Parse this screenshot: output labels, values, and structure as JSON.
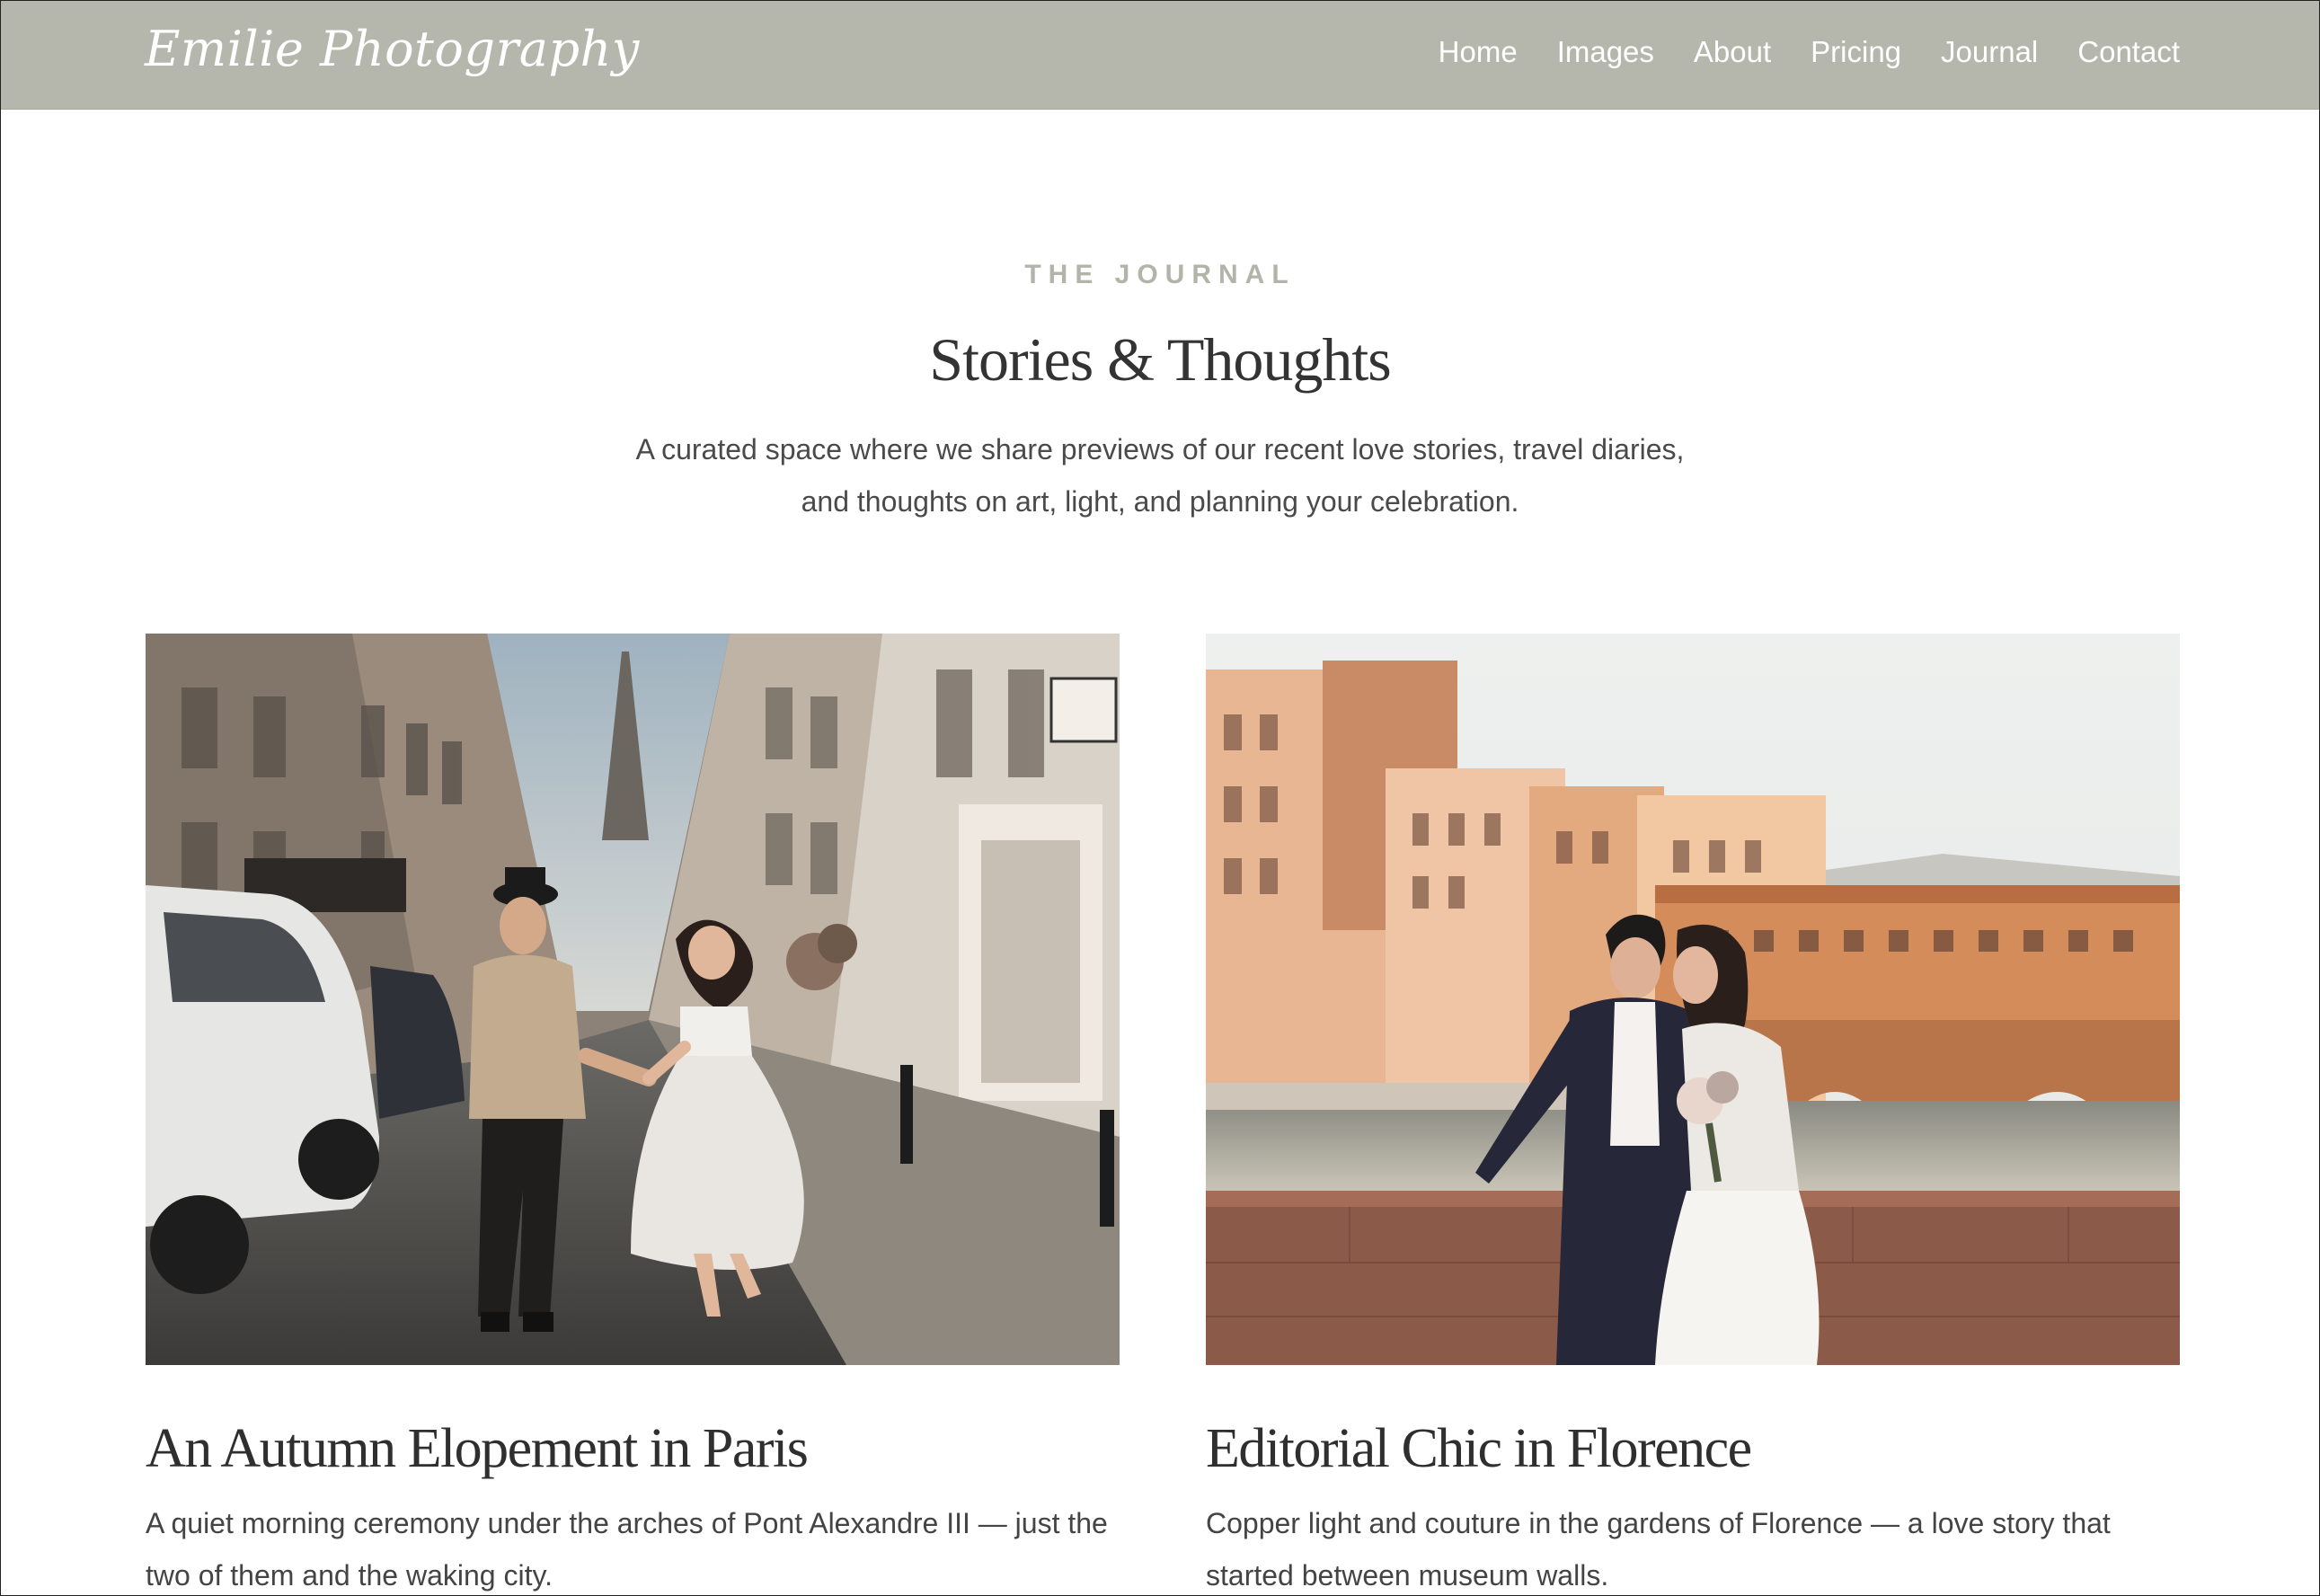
{
  "header": {
    "logo": "Emilie Photography",
    "nav": [
      "Home",
      "Images",
      "About",
      "Pricing",
      "Journal",
      "Contact"
    ]
  },
  "intro": {
    "eyebrow": "THE JOURNAL",
    "title": "Stories & Thoughts",
    "description": "A curated space where we share previews of our recent love stories, travel diaries, and thoughts on art, light, and planning your celebration."
  },
  "posts": [
    {
      "title": "An Autumn Elopement in Paris",
      "excerpt": "A quiet morning ceremony under the arches of Pont Alexandre III — just the two of them and the waking city.",
      "image": "paris-street-couple-photo"
    },
    {
      "title": "Editorial Chic in Florence",
      "excerpt": "Copper light and couture in the gardens of Florence — a love story that started between museum walls.",
      "image": "florence-bridge-couple-photo"
    }
  ],
  "colors": {
    "header_bg": "#b5b6ac",
    "eyebrow": "#b3b4a9",
    "text": "#3d3d3d"
  }
}
